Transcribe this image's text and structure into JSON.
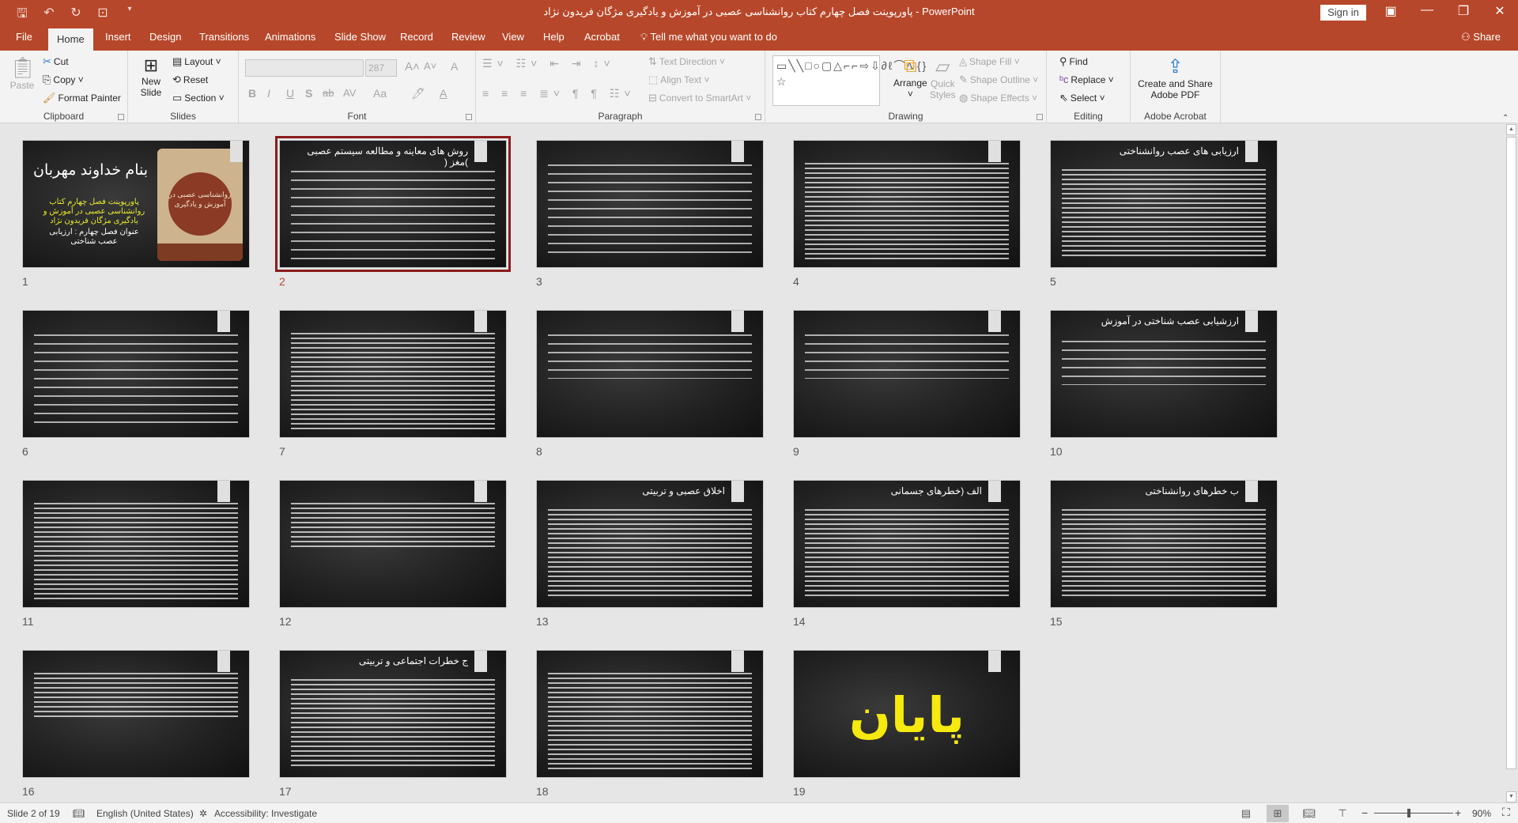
{
  "window": {
    "title": "پاورپوینت فصل چهارم کتاب روانشناسی عصبی در آموزش و یادگیری مژگان فریدون نژاد  -  PowerPoint",
    "sign_in": "Sign in",
    "quick_access": [
      "save-icon",
      "undo-icon",
      "redo-icon",
      "start-presentation-icon",
      "customize-icon"
    ],
    "controls": {
      "ribbon_display": "▣",
      "minimize": "—",
      "restore": "❐",
      "close": "✕"
    }
  },
  "tabs": [
    {
      "label": "File"
    },
    {
      "label": "Home",
      "active": true
    },
    {
      "label": "Insert"
    },
    {
      "label": "Design"
    },
    {
      "label": "Transitions"
    },
    {
      "label": "Animations"
    },
    {
      "label": "Slide Show"
    },
    {
      "label": "Record"
    },
    {
      "label": "Review"
    },
    {
      "label": "View"
    },
    {
      "label": "Help"
    },
    {
      "label": "Acrobat"
    }
  ],
  "tell_me": "Tell me what you want to do",
  "share": "Share",
  "ribbon": {
    "clipboard": {
      "label": "Clipboard",
      "paste": "Paste",
      "cut": "Cut",
      "copy": "Copy",
      "format_painter": "Format Painter"
    },
    "slides": {
      "label": "Slides",
      "new_slide_1": "New",
      "new_slide_2": "Slide",
      "layout": "Layout",
      "reset": "Reset",
      "section": "Section"
    },
    "font": {
      "label": "Font",
      "font_name": "",
      "font_size": "287",
      "bold": "B",
      "italic": "I",
      "underline": "U",
      "shadow": "S",
      "strike": "ab",
      "spacing": "AV",
      "case": "Aa",
      "grow": "A˄",
      "shrink": "A˅",
      "clear": "A"
    },
    "paragraph": {
      "label": "Paragraph",
      "text_direction": "Text Direction",
      "align_text": "Align Text",
      "convert_smartart": "Convert to SmartArt"
    },
    "drawing": {
      "label": "Drawing",
      "arrange": "Arrange",
      "quick_styles_1": "Quick",
      "quick_styles_2": "Styles",
      "shape_fill": "Shape Fill",
      "shape_outline": "Shape Outline",
      "shape_effects": "Shape Effects",
      "shapes_gallery": "▭╲╲□○▢△⌐⌐⇨⇩∂ℓ⌒∿{}☆"
    },
    "editing": {
      "label": "Editing",
      "find": "Find",
      "replace": "Replace",
      "select": "Select"
    },
    "acrobat": {
      "label": "Adobe Acrobat",
      "create_1": "Create and Share",
      "create_2": "Adobe PDF"
    }
  },
  "slides": [
    {
      "num": "1",
      "title": "بنام خداوند مهربان",
      "subtitle": "پاورپوینت فصل چهارم کتاب روانشناسی عصبی در آموزش و یادگیری مژگان فریدون نژاد",
      "note": "عنوان فصل چهارم : ارزیابی عصب شناختی",
      "cover_text": "روانشناسی عصبی در آموزش و یادگیری"
    },
    {
      "num": "2",
      "title": "روش های معاینه و مطالعه سیستم عصبی )مغز (",
      "selected": true
    },
    {
      "num": "3",
      "title": ""
    },
    {
      "num": "4",
      "title": ""
    },
    {
      "num": "5",
      "title": "ارزیابی های عصب روانشناختی"
    },
    {
      "num": "6",
      "title": ""
    },
    {
      "num": "7",
      "title": ""
    },
    {
      "num": "8",
      "title": ""
    },
    {
      "num": "9",
      "title": ""
    },
    {
      "num": "10",
      "title": "ارزشیابی عصب شناختی در آموزش"
    },
    {
      "num": "11",
      "title": ""
    },
    {
      "num": "12",
      "title": ""
    },
    {
      "num": "13",
      "title": "اخلاق عصبی و تربیتی"
    },
    {
      "num": "14",
      "title": "الف (خطرهای جسمانی"
    },
    {
      "num": "15",
      "title": "ب خطرهای روانشناختی"
    },
    {
      "num": "16",
      "title": ""
    },
    {
      "num": "17",
      "title": "ج خطرات اجتماعی و تربیتی"
    },
    {
      "num": "18",
      "title": ""
    },
    {
      "num": "19",
      "title": "پایان"
    }
  ],
  "status": {
    "slide_info": "Slide 2 of 19",
    "language": "English (United States)",
    "accessibility": "Accessibility: Investigate",
    "zoom": "90%",
    "zoom_fraction": 0.9
  }
}
